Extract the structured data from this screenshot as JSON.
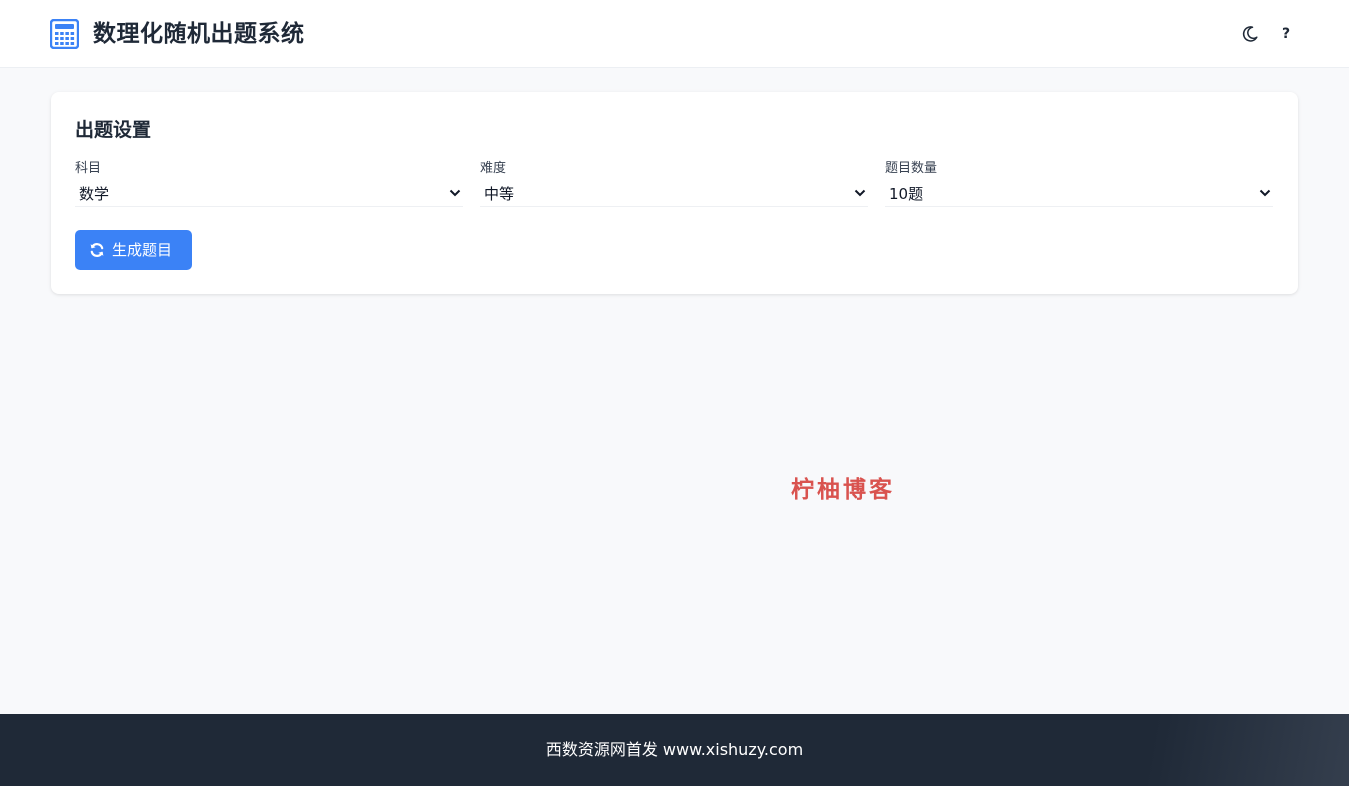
{
  "header": {
    "title": "数理化随机出题系统",
    "logo_icon": "calculator-icon",
    "theme_toggle_icon": "moon-icon",
    "help_label": "?"
  },
  "settings": {
    "title": "出题设置",
    "fields": [
      {
        "label": "科目",
        "selected": "数学"
      },
      {
        "label": "难度",
        "selected": "中等"
      },
      {
        "label": "题目数量",
        "selected": "10题"
      }
    ],
    "generate_button": {
      "label": "生成题目",
      "icon": "refresh-icon"
    }
  },
  "watermark": "柠柚博客",
  "footer": {
    "text": "西数资源网首发 www.xishuzy.com"
  },
  "colors": {
    "accent": "#3b82f6",
    "footer_bg": "#1f2937",
    "page_bg": "#f8f9fb",
    "watermark": "#d9534f"
  }
}
